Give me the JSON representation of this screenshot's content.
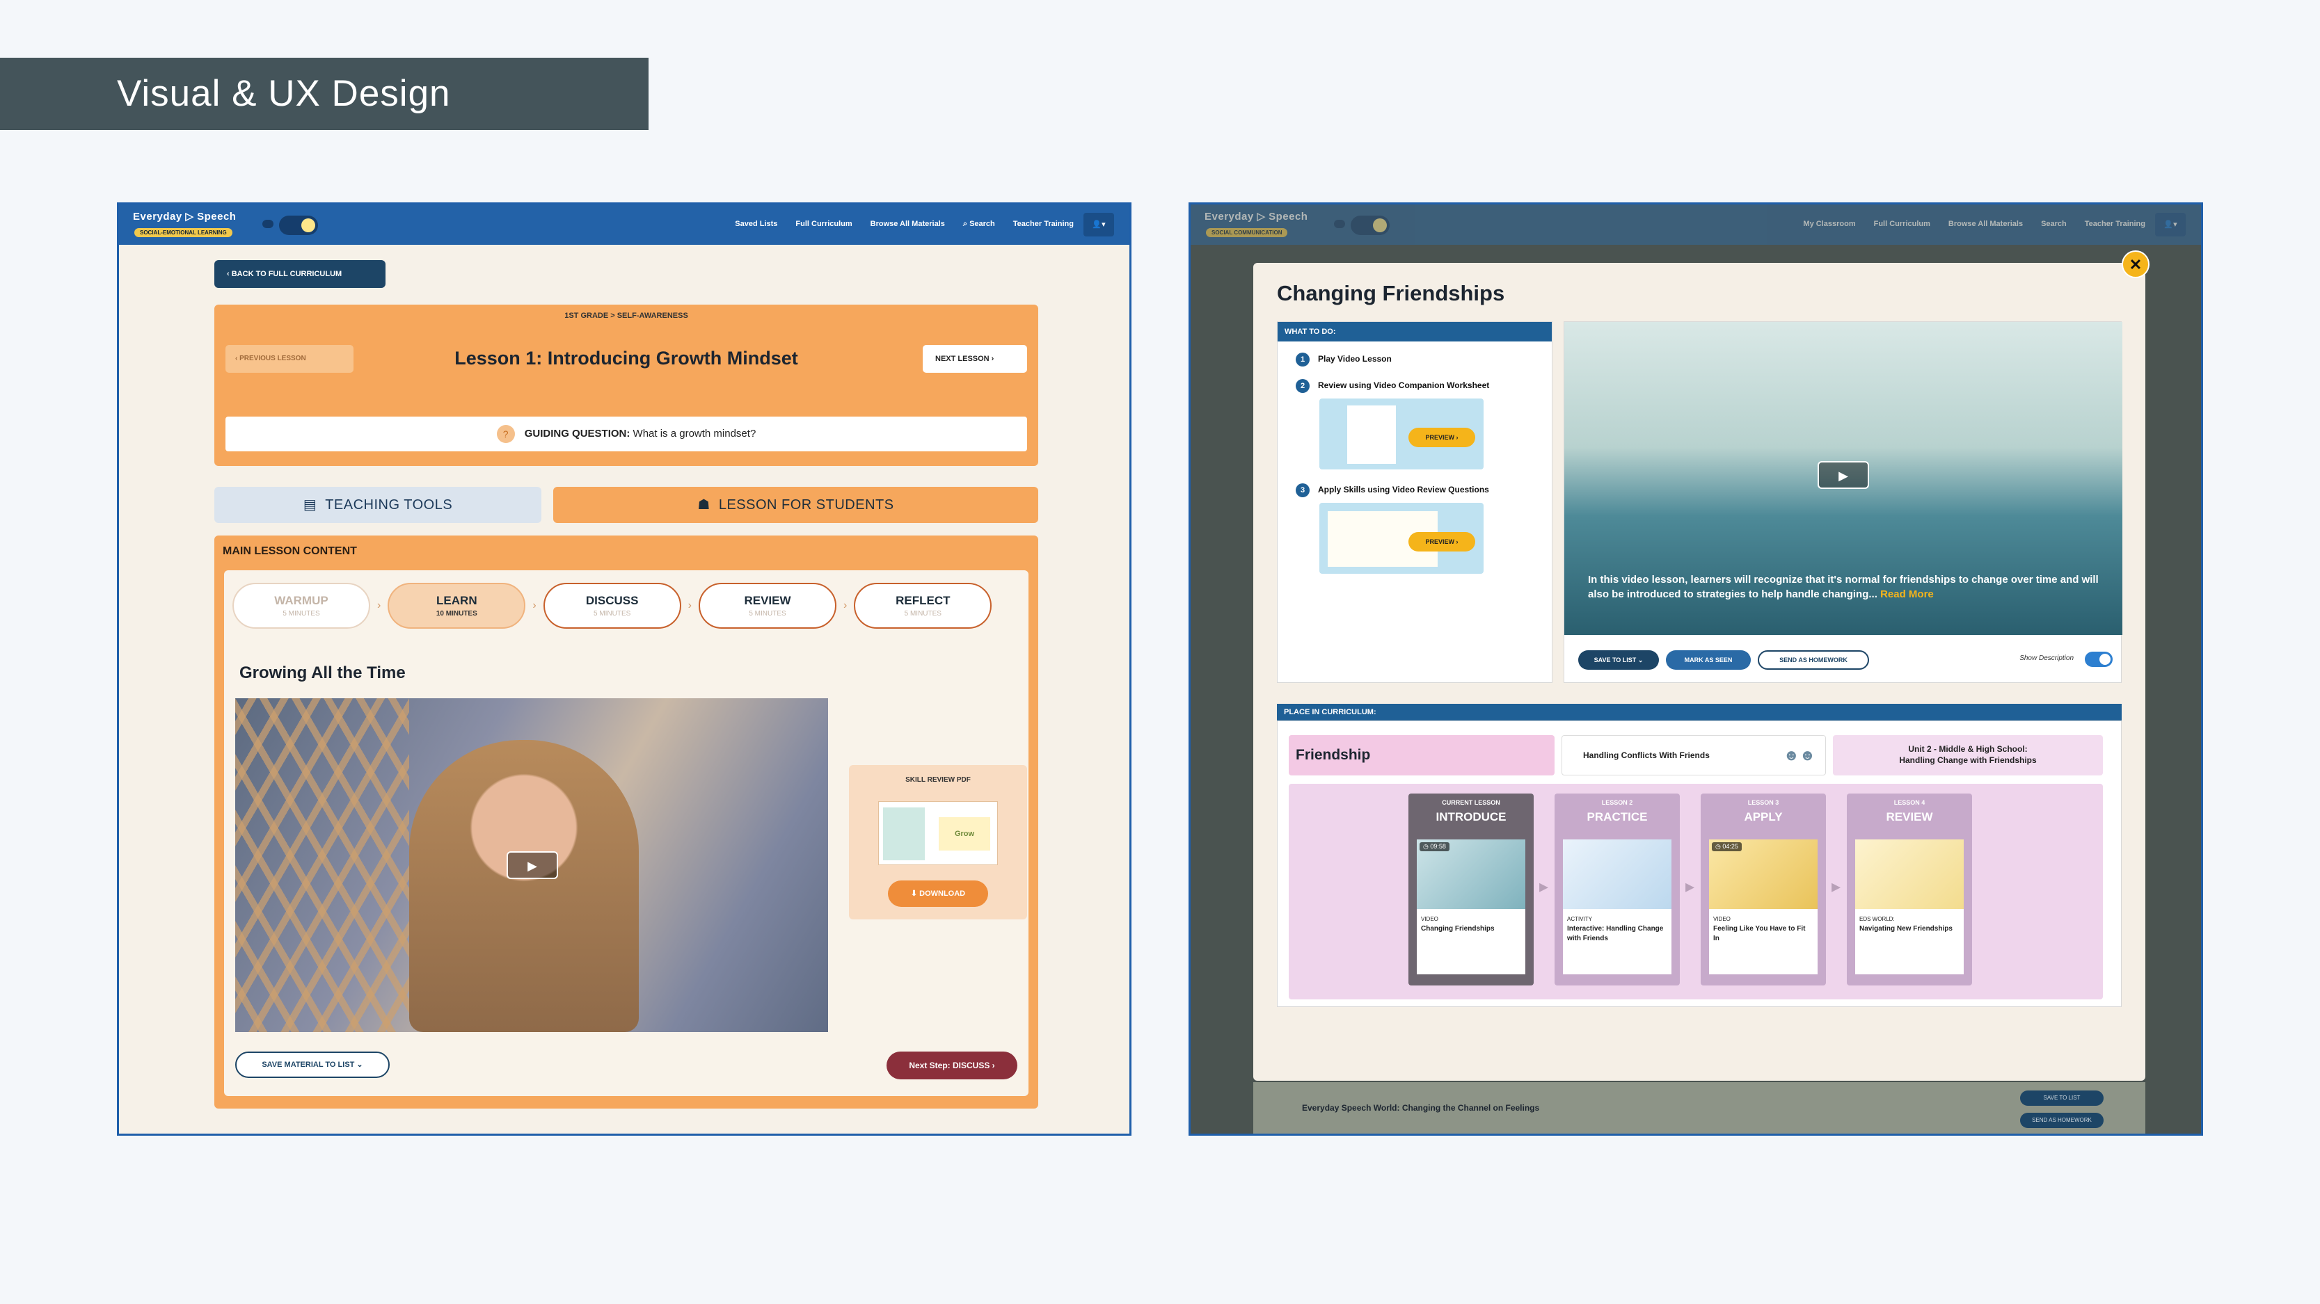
{
  "page_header": "Visual & UX Design",
  "left": {
    "brand": "Everyday ▷ Speech",
    "brand_sub": "SOCIAL-EMOTIONAL LEARNING",
    "nav_links": [
      "Saved Lists",
      "Full Curriculum",
      "Browse All Materials",
      "Search",
      "Teacher Training"
    ],
    "back_button": "BACK TO FULL CURRICULUM",
    "grade": "1ST GRADE > SELF-AWARENESS",
    "prev_lesson": "PREVIOUS LESSON",
    "next_lesson": "NEXT LESSON",
    "lesson_title": "Lesson 1: Introducing Growth Mindset",
    "guiding_label": "GUIDING QUESTION:",
    "guiding_text": "What is a growth mindset?",
    "tab_tools": "TEACHING TOOLS",
    "tab_students": "LESSON FOR STUDENTS",
    "main_label": "MAIN LESSON CONTENT",
    "steps": [
      {
        "name": "WARMUP",
        "mins": "5 MINUTES"
      },
      {
        "name": "LEARN",
        "mins": "10 MINUTES"
      },
      {
        "name": "DISCUSS",
        "mins": "5 MINUTES"
      },
      {
        "name": "REVIEW",
        "mins": "5 MINUTES"
      },
      {
        "name": "REFLECT",
        "mins": "5 MINUTES"
      }
    ],
    "section_title": "Growing All the Time",
    "pdf_label": "SKILL REVIEW PDF",
    "pdf_thumb_word": "Grow",
    "download": "DOWNLOAD",
    "save_material": "SAVE MATERIAL TO LIST",
    "next_step": "Next Step: DISCUSS"
  },
  "right": {
    "brand": "Everyday ▷ Speech",
    "brand_sub": "SOCIAL COMMUNICATION",
    "nav_links": [
      "My Classroom",
      "Full Curriculum",
      "Browse All Materials",
      "Search",
      "Teacher Training"
    ],
    "modal_title": "Changing Friendships",
    "todo_header": "WHAT TO DO:",
    "todo": [
      {
        "num": "1",
        "text": "Play Video Lesson"
      },
      {
        "num": "2",
        "text": "Review using Video Companion Worksheet"
      },
      {
        "num": "3",
        "text": "Apply Skills using Video Review Questions"
      }
    ],
    "preview": "PREVIEW",
    "video_desc": "In this video lesson, learners will recognize that it's normal for friendships to change over time and will also be introduced to strategies to help handle changing...",
    "read_more": "Read More",
    "save_to_list": "SAVE TO LIST",
    "mark_seen": "MARK AS SEEN",
    "send_homework": "SEND AS HOMEWORK",
    "show_description": "Show Description",
    "place_header": "PLACE IN CURRICULUM:",
    "crumb_friend": "Friendship",
    "crumb_conflicts": "Handling Conflicts With Friends",
    "crumb_unit_1": "Unit 2 - Middle & High School:",
    "crumb_unit_2": "Handling Change with Friendships",
    "lessons": [
      {
        "label": "CURRENT LESSON",
        "name": "INTRODUCE",
        "dur": "09:58",
        "kind": "VIDEO",
        "title": "Changing Friendships"
      },
      {
        "label": "LESSON 2",
        "name": "PRACTICE",
        "dur": "",
        "kind": "ACTIVITY",
        "title": "Interactive: Handling Change with Friends"
      },
      {
        "label": "LESSON 3",
        "name": "APPLY",
        "dur": "04:25",
        "kind": "VIDEO",
        "title": "Feeling Like You Have to Fit In"
      },
      {
        "label": "LESSON 4",
        "name": "REVIEW",
        "dur": "",
        "kind": "EDS WORLD:",
        "title": "Navigating New Friendships"
      }
    ],
    "bottom_title": "Everyday Speech World: Changing the Channel on Feelings",
    "bottom_save": "SAVE TO LIST",
    "bottom_send": "SEND AS HOMEWORK"
  }
}
